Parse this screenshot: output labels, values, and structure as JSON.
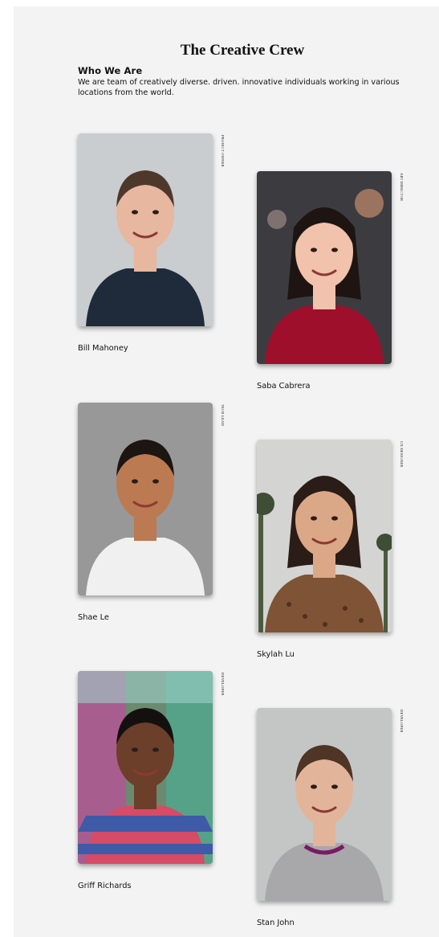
{
  "header": {
    "title": "The Creative Crew",
    "subtitle": "Who We Are",
    "intro": "We are team of creatively diverse. driven. innovative individuals working in various locations from the world."
  },
  "members": [
    {
      "name": "Bill Mahoney",
      "role": "Project Owner",
      "icon": "portrait-man-polo-shirt",
      "colors": {
        "background": "#c9cdd0",
        "shirt": "#1f2b3a",
        "skin": "#e7b7a0",
        "hair": "#4e382b"
      }
    },
    {
      "name": "Saba Cabrera",
      "role": "Art Director",
      "icon": "portrait-woman-red-sweater",
      "colors": {
        "background": "#3c3c40",
        "shirt": "#9e0f2b",
        "skin": "#f1c2ac",
        "hair": "#1e1512"
      }
    },
    {
      "name": "Shae Le",
      "role": "Tech Lead",
      "icon": "portrait-man-white-tshirt",
      "colors": {
        "background": "#8f8f8f",
        "shirt": "#f0f0f0",
        "skin": "#bb7a52",
        "hair": "#1d1511"
      }
    },
    {
      "name": "Skylah Lu",
      "role": "UX Designer",
      "icon": "portrait-woman-leopard-top",
      "colors": {
        "background": "#d4d4d2",
        "shirt": "#7f5336",
        "skin": "#dba887",
        "hair": "#2a1c16"
      }
    },
    {
      "name": "Griff Richards",
      "role": "Developer",
      "icon": "portrait-man-striped-shirt",
      "colors": {
        "background": "#6b8a6f",
        "shirt": "#d64b66",
        "skin": "#6b3f2a",
        "hair": "#141010"
      }
    },
    {
      "name": "Stan John",
      "role": "Developer",
      "icon": "portrait-man-grey-sweater",
      "colors": {
        "background": "#c4c6c6",
        "shirt": "#a8a8aa",
        "skin": "#e2b59b",
        "hair": "#4e3526"
      }
    }
  ]
}
